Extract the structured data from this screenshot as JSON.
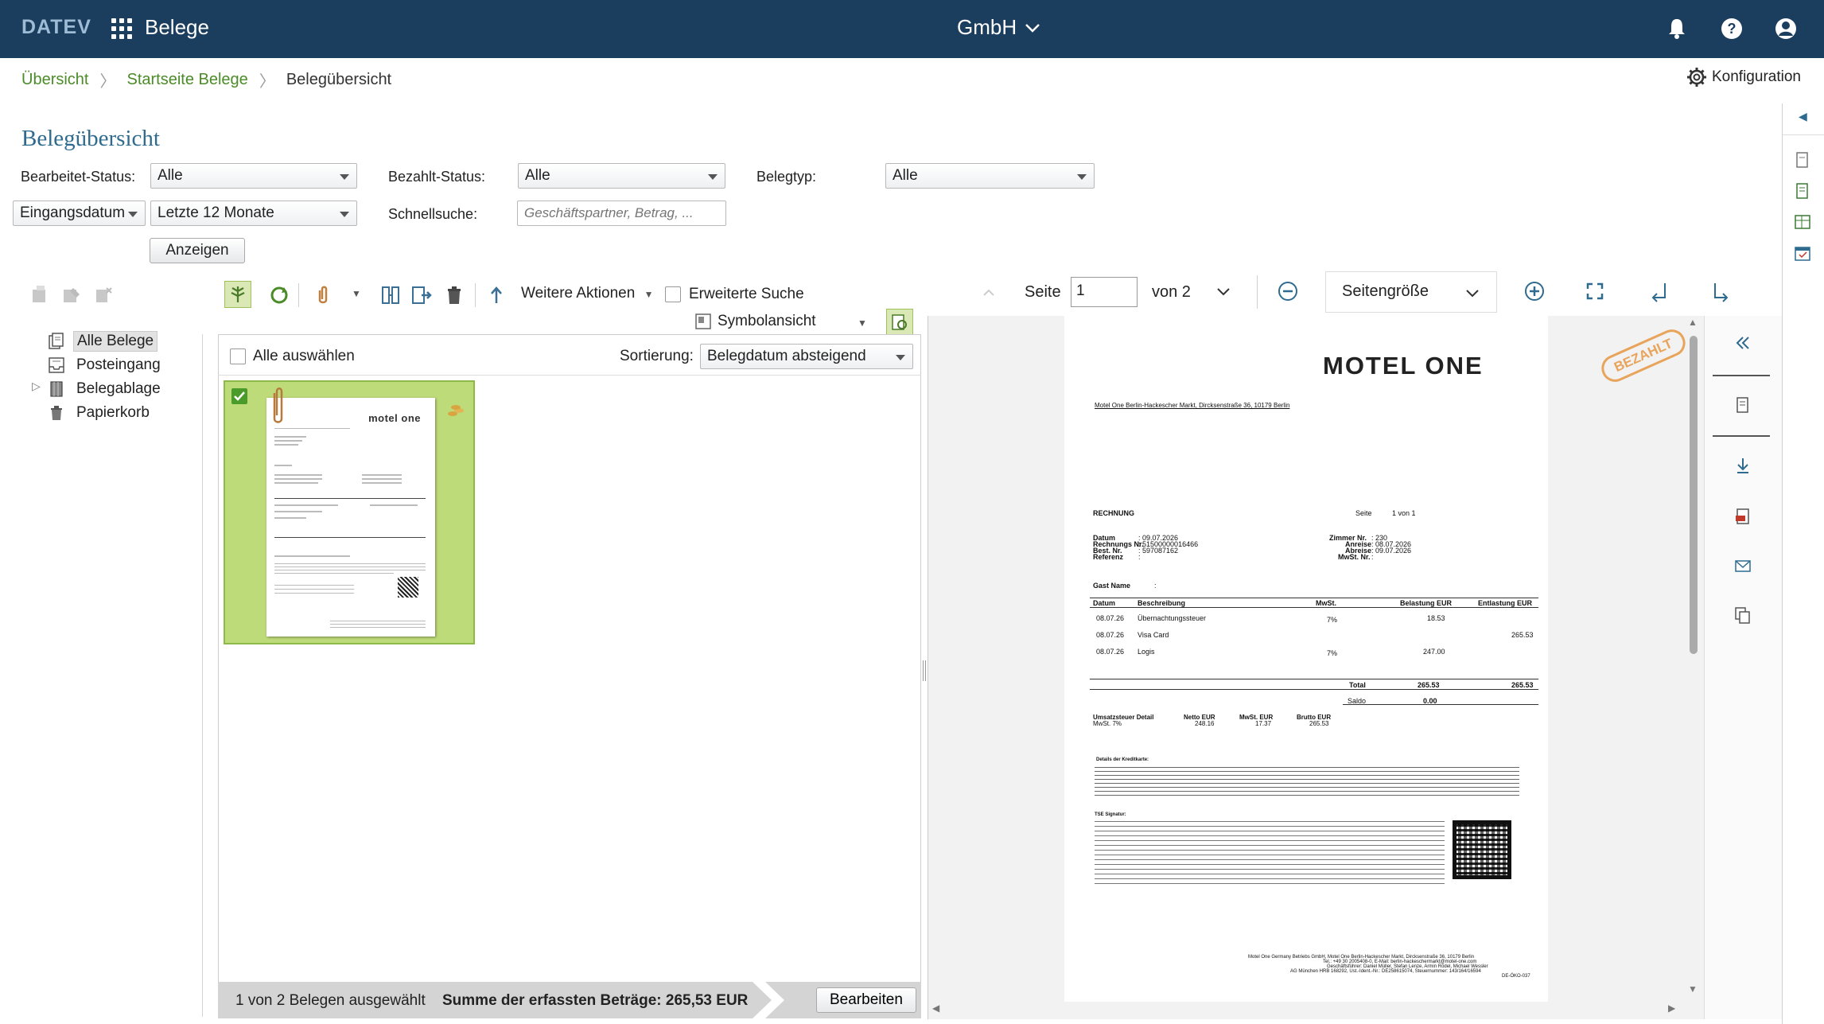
{
  "app": {
    "logo": "DATEV",
    "title": "Belege",
    "company": "GmbH"
  },
  "breadcrumb": {
    "items": [
      "Übersicht",
      "Startseite Belege"
    ],
    "current": "Belegübersicht"
  },
  "konfiguration_label": "Konfiguration",
  "page_title": "Belegübersicht",
  "filters": {
    "bearbeitet_label": "Bearbeitet-Status:",
    "bearbeitet_value": "Alle",
    "bezahlt_label": "Bezahlt-Status:",
    "bezahlt_value": "Alle",
    "belegtyp_label": "Belegtyp:",
    "belegtyp_value": "Alle",
    "datum_field": "Eingangsdatum",
    "zeitraum_value": "Letzte 12 Monate",
    "schnellsuche_label": "Schnellsuche:",
    "schnellsuche_placeholder": "Geschäftspartner, Betrag, ...",
    "anzeigen_label": "Anzeigen"
  },
  "toolbar": {
    "weitere_aktionen": "Weitere Aktionen",
    "erweiterte_suche": "Erweiterte Suche",
    "symbolansicht": "Symbolansicht"
  },
  "tree": {
    "items": [
      "Alle Belege",
      "Posteingang",
      "Belegablage",
      "Papierkorb"
    ]
  },
  "list": {
    "select_all": "Alle auswählen",
    "sort_label": "Sortierung:",
    "sort_value": "Belegdatum absteigend"
  },
  "thumbnail": {
    "logo_text": "motel one"
  },
  "status": {
    "selected": "1 von 2 Belegen ausgewählt",
    "sum": "Summe der erfassten Beträge: 265,53 EUR",
    "edit": "Bearbeiten"
  },
  "viewer": {
    "seite_label": "Seite",
    "page_value": "1",
    "of_label": "von 2",
    "zoom_value": "Seitengröße",
    "stamp": "BEZAHLT"
  },
  "invoice": {
    "logo": "MOTEL ONE",
    "sender": "Motel One Berlin-Hackescher Markt, Dircksenstraße 36, 10179 Berlin",
    "title": "RECHNUNG",
    "seite": "Seite",
    "seite_value": "1 von 1",
    "left_fields": [
      {
        "k": "Datum",
        "v": "09.07.2026"
      },
      {
        "k": "Rechnungs Nr.",
        "v": "51500000016466"
      },
      {
        "k": "Best. Nr.",
        "v": "597087162"
      },
      {
        "k": "Referenz",
        "v": ""
      }
    ],
    "right_fields": [
      {
        "k": "Zimmer Nr.",
        "v": "230"
      },
      {
        "k": "Anreise",
        "v": "08.07.2026"
      },
      {
        "k": "Abreise",
        "v": "09.07.2026"
      },
      {
        "k": "MwSt. Nr.",
        "v": ""
      }
    ],
    "gast_label": "Gast Name",
    "columns": [
      "Datum",
      "Beschreibung",
      "MwSt.",
      "Belastung EUR",
      "Entlastung EUR"
    ],
    "rows": [
      {
        "d": "08.07.26",
        "desc": "Übernachtungssteuer",
        "vat": "7%",
        "deb": "18.53",
        "cred": ""
      },
      {
        "d": "08.07.26",
        "desc": "Visa Card",
        "vat": "",
        "deb": "",
        "cred": "265.53"
      },
      {
        "d": "08.07.26",
        "desc": "Logis",
        "vat": "7%",
        "deb": "247.00",
        "cred": ""
      }
    ],
    "total_label": "Total",
    "total_deb": "265.53",
    "total_cred": "265.53",
    "saldo_label": "Saldo",
    "saldo_value": "0.00",
    "vat_head": [
      "Umsatzsteuer Detail",
      "Netto EUR",
      "MwSt. EUR",
      "Brutto EUR"
    ],
    "vat_row": [
      "MwSt. 7%",
      "248.16",
      "17.37",
      "265.53"
    ],
    "card_title": "Details der Kreditkarte:",
    "tse_title": "TSE Signatur:",
    "footer_1": "Motel One Germany Betriebs GmbH, Motel One Berlin-Hackescher Markt, Dircksenstraße 36, 10179 Berlin",
    "footer_2": "Tel.: +49 30 2005408-0, E-Mail: berlin-hackeschermarkt@motel-one.com",
    "footer_3": "Geschäftsführer: Daniel Müller, Stefan Lenze, Armin Rödel, Michael Wessler",
    "footer_4": "AG München HRB 168292, Ust.-Ident.-Nr.: DE258615074, Steuernummer: 143/164/16594",
    "footer_5": "DE-ÖKO-037"
  },
  "colors": {
    "topbar": "#1b3d5e",
    "link_green": "#4b8b28",
    "title_blue": "#2e6b8f",
    "thumb_selected": "#bedb7a",
    "stamp_orange": "#e8a45b"
  }
}
